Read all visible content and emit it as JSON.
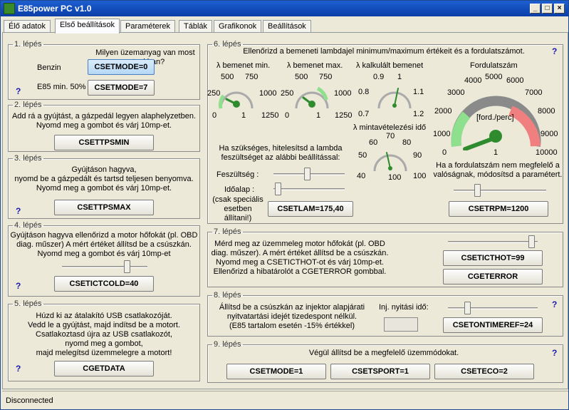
{
  "window": {
    "title": "E85power PC v1.0",
    "min": "_",
    "max": "□",
    "close": "×"
  },
  "tabs": [
    "Élő adatok",
    "Első beállítások",
    "Paraméterek",
    "Táblák",
    "Grafikonok",
    "Beállítások"
  ],
  "help": "?",
  "s1": {
    "legend": "1. lépés",
    "question": "Milyen üzemanyag van most a tankban?",
    "benzin": "Benzin",
    "e85": "E85 min. 50%",
    "btn1": "CSETMODE=0",
    "btn2": "CSETMODE=7"
  },
  "s2": {
    "legend": "2. lépés",
    "text1": "Add rá a gyújtást, a gázpedál legyen alaphelyzetben.",
    "text2": "Nyomd meg a gombot és várj 10mp-et.",
    "btn": "CSETTPSMIN"
  },
  "s3": {
    "legend": "3. lépés",
    "text1": "Gyújtáson hagyva,",
    "text2": "nyomd be a gázpedált és tartsd teljesen benyomva.",
    "text3": "Nyomd meg a gombot és várj 10mp-et.",
    "btn": "CSETTPSMAX"
  },
  "s4": {
    "legend": "4. lépés",
    "text1": "Gyújtáson hagyva ellenőrizd a motor hőfokát (pl. OBD",
    "text2": "diag. műszer) A mért értéket állítsd be a csúszkán.",
    "text3": "Nyomd meg a gombot és várj 10mp-et",
    "btn": "CSETICTCOLD=40",
    "slider": 0.78
  },
  "s5": {
    "legend": "5. lépés",
    "text1": "Húzd ki az átalakító USB csatlakozóját.",
    "text2": "Vedd le a gyújtást, majd indítsd be a motort.",
    "text3": "Csatlakoztasd újra az USB csatlakozót,",
    "text4": "nyomd meg a gombot,",
    "text5": "majd melegítsd üzemmelegre a motort!",
    "btn": "CGETDATA"
  },
  "s6": {
    "legend": "6. lépés",
    "header": "Ellenőrizd a bemeneti lambdajel minimum/maximum értékeit és a fordulatszámot.",
    "g1": {
      "title": "λ bemenet min.",
      "ticks": [
        "0",
        "250",
        "500",
        "750",
        "1000",
        "1",
        "1250"
      ]
    },
    "g2": {
      "title": "λ bemenet max.",
      "ticks": [
        "0",
        "250",
        "500",
        "750",
        "1000",
        "1",
        "1250"
      ]
    },
    "g3": {
      "title": "λ kalkulált bemenet",
      "ticks": [
        "0.7",
        "0.8",
        "0.9",
        "1",
        "1.1",
        "1.2"
      ]
    },
    "g4": {
      "title": "λ mintavételezési idő",
      "ticks": [
        "40",
        "50",
        "60",
        "70",
        "80",
        "90",
        "100"
      ]
    },
    "rpm": {
      "title": "Fordulatszám",
      "unit": "[ford./perc]",
      "ticks": [
        "0",
        "1000",
        "2000",
        "3000",
        "4000",
        "5000",
        "6000",
        "7000",
        "8000",
        "9000",
        "10000",
        "1"
      ]
    },
    "calib1": "Ha szükséges, hitelesítsd a lambda",
    "calib2": "feszültséget az alábbi beállítással:",
    "voltage": "Feszültség :",
    "base": "Időalap :",
    "special1": "(csak speciális",
    "special2": "esetben állítani!)",
    "btn": "CSETLAM=175,40",
    "rpm_note1": "Ha a fordulatszám nem megfelelő a",
    "rpm_note2": "valóságnak, módosítsd a paramétert.",
    "rpm_btn": "CSETRPM=1200",
    "slider_v": 0.47,
    "slider_b": 0.02,
    "slider_rpm": 0.24
  },
  "s7": {
    "legend": "7. lépés",
    "text1": "Mérd meg az üzemmeleg motor hőfokát (pl. OBD",
    "text2": "diag. műszer). A mért értéket állítsd be a csúszkán.",
    "text3": "Nyomd meg a CSETICTHOT-ot és várj 10mp-et.",
    "text4": "Ellenőrizd a hibatárolót a CGETERROR gombbal.",
    "btn1": "CSETICTHOT=99",
    "btn2": "CGETERROR",
    "slider": 0.97
  },
  "s8": {
    "legend": "8. lépés",
    "text1": "Állítsd be a csúszkán az injektor alapjárati",
    "text2": "nyitvatartási idejét tizedespont nélkül.",
    "text3": "(E85 tartalom esetén -15% értékkel)",
    "inj": "Inj. nyitási idő:",
    "btn": "CSETONTIMEREF=24",
    "slider": 0.2
  },
  "s9": {
    "legend": "9. lépés",
    "text": "Végül állítsd be a megfelelő üzemmódokat.",
    "btn1": "CSETMODE=1",
    "btn2": "CSETSPORT=1",
    "btn3": "CSETECO=2"
  },
  "status": "Disconnected",
  "colors": {
    "green": "#2e8b2e",
    "green_zone": "#8ee08e",
    "red_zone": "#f08080"
  }
}
